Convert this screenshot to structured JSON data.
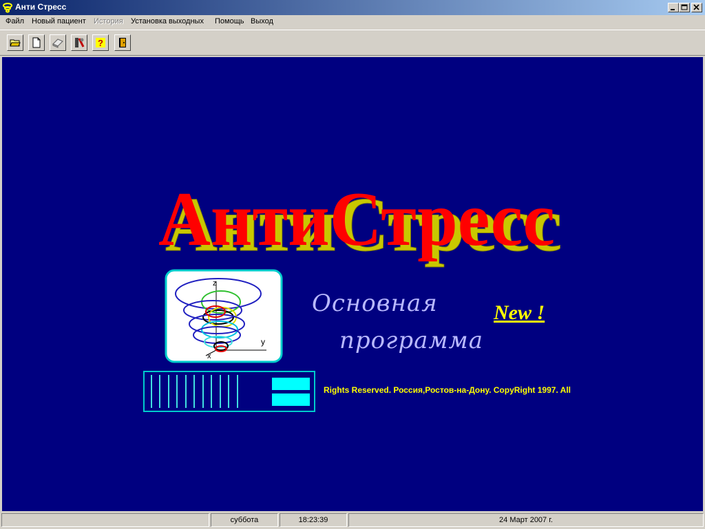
{
  "window": {
    "title": "Анти Стресс"
  },
  "menu": [
    {
      "label": "Файл",
      "disabled": false
    },
    {
      "label": "Новый пациент",
      "disabled": false
    },
    {
      "label": "История",
      "disabled": true
    },
    {
      "label": "Установка выходных",
      "disabled": false
    },
    {
      "label": "Помощь",
      "disabled": false
    },
    {
      "label": "Выход",
      "disabled": false
    }
  ],
  "toolbar": {
    "buttons": [
      {
        "icon": "open-folder-icon"
      },
      {
        "icon": "new-document-icon"
      },
      {
        "icon": "eraser-icon"
      },
      {
        "icon": "settings-tools-icon"
      },
      {
        "icon": "help-icon"
      },
      {
        "icon": "exit-door-icon"
      }
    ]
  },
  "splash": {
    "logo_text": "АнтиСтресс",
    "subtitle_line1": "Основная",
    "subtitle_line2": "программа",
    "new_badge": "New !",
    "copyright": "Rights Reserved. Россия,Ростов-на-Дону. CopyRight 1997. All",
    "axis_x": "x",
    "axis_y": "y",
    "axis_z": "z"
  },
  "statusbar": {
    "day": "суббота",
    "time": "18:23:39",
    "date": "24 Март 2007 г."
  },
  "colors": {
    "background": "#000080",
    "logo_red": "#ff0000",
    "logo_shadow": "#c8c800",
    "accent_yellow": "#ffff00",
    "subtitle": "#b9b9ff",
    "cyan": "#00ffff"
  }
}
